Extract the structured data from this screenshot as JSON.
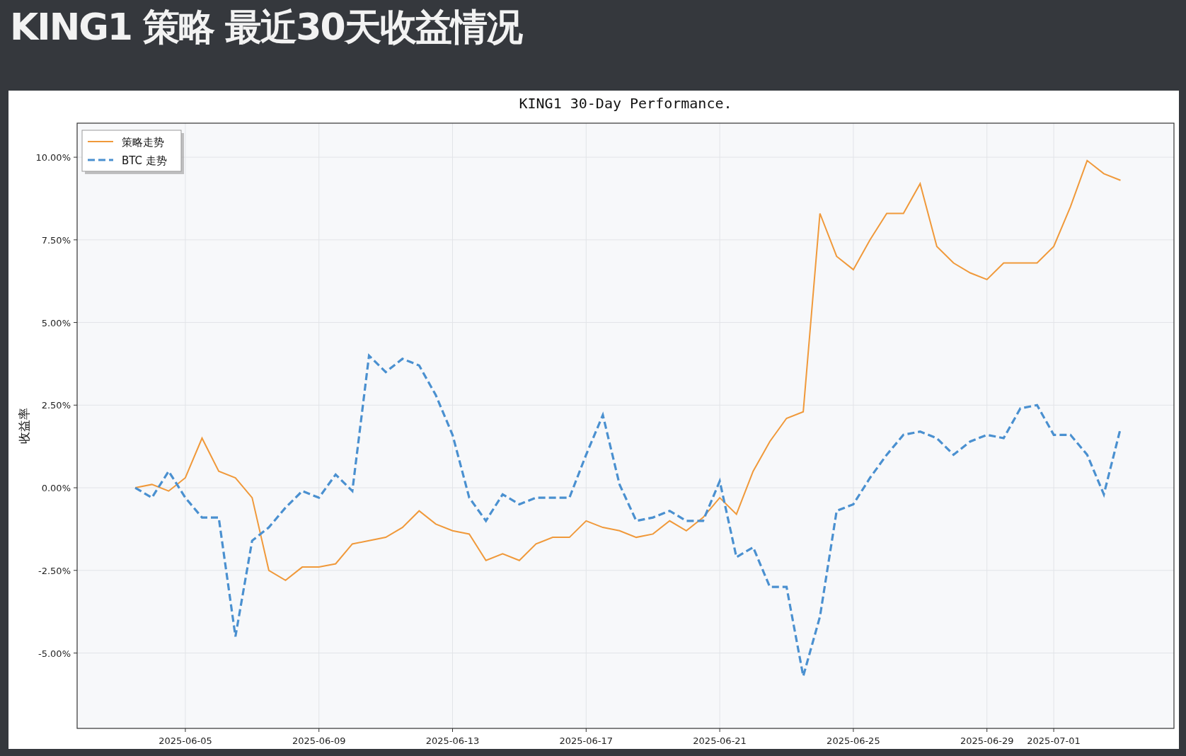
{
  "page": {
    "title": "KING1 策略 最近30天收益情况"
  },
  "chart": {
    "chart_data": {
      "type": "line",
      "grid": true,
      "legend": "upper left",
      "title": "KING1 30-Day Performance.",
      "ylabel": "收益率",
      "categories": [
        null,
        null,
        null,
        "2025-06-05",
        null,
        null,
        null,
        null,
        null,
        null,
        null,
        "2025-06-09",
        null,
        null,
        null,
        null,
        null,
        null,
        null,
        "2025-06-13",
        null,
        null,
        null,
        null,
        null,
        null,
        null,
        "2025-06-17",
        null,
        null,
        null,
        null,
        null,
        null,
        null,
        "2025-06-21",
        null,
        null,
        null,
        null,
        null,
        null,
        null,
        "2025-06-25",
        null,
        null,
        null,
        null,
        null,
        null,
        null,
        "2025-06-29",
        null,
        null,
        null,
        "2025-07-01",
        null,
        null,
        null,
        null
      ],
      "series": [
        {
          "name": "策略走势",
          "color": "#f0993a",
          "line_style": "solid",
          "values": [
            0,
            0.1,
            -0.1,
            0.3,
            1.5,
            0.5,
            0.3,
            -0.3,
            -2.5,
            -2.8,
            -2.4,
            -2.4,
            -2.3,
            -1.7,
            -1.6,
            -1.5,
            -1.2,
            -0.7,
            -1.1,
            -1.3,
            -1.4,
            -2.2,
            -2.0,
            -2.2,
            -1.7,
            -1.5,
            -1.5,
            -1.0,
            -1.2,
            -1.3,
            -1.5,
            -1.4,
            -1.0,
            -1.3,
            -0.9,
            -0.3,
            -0.8,
            0.5,
            1.4,
            2.1,
            2.3,
            8.3,
            7.0,
            6.6,
            7.5,
            8.3,
            8.3,
            9.2,
            7.3,
            6.8,
            6.5,
            6.3,
            6.8,
            6.8,
            6.8,
            7.3,
            8.5,
            9.9,
            9.5,
            9.3
          ]
        },
        {
          "name": "BTC 走势",
          "color": "#4a90d0",
          "line_style": "dashed",
          "values": [
            0,
            -0.3,
            0.5,
            -0.3,
            -0.9,
            -0.9,
            -4.5,
            -1.6,
            -1.2,
            -0.6,
            -0.1,
            -0.3,
            0.4,
            -0.1,
            4.0,
            3.5,
            3.9,
            3.7,
            2.8,
            1.6,
            -0.3,
            -1.0,
            -0.2,
            -0.5,
            -0.3,
            -0.3,
            -0.3,
            1.0,
            2.2,
            0.1,
            -1.0,
            -0.9,
            -0.7,
            -1.0,
            -1.0,
            0.2,
            -2.1,
            -1.8,
            -3.0,
            -3.0,
            -5.7,
            -3.9,
            -0.7,
            -0.5,
            0.3,
            1.0,
            1.6,
            1.7,
            1.5,
            1.0,
            1.4,
            1.6,
            1.5,
            2.4,
            2.5,
            1.6,
            1.6,
            1.0,
            -0.2,
            1.8
          ]
        }
      ],
      "ylim": [
        -7.28,
        11.03
      ],
      "yticks": [
        {
          "value": -5,
          "label": "-5.00%"
        },
        {
          "value": -2.5,
          "label": "-2.50%"
        },
        {
          "value": 0,
          "label": "0.00%"
        },
        {
          "value": 2.5,
          "label": "2.50%"
        },
        {
          "value": 5,
          "label": "5.00%"
        },
        {
          "value": 7.5,
          "label": "7.50%"
        },
        {
          "value": 10,
          "label": "10.00%"
        }
      ]
    }
  }
}
